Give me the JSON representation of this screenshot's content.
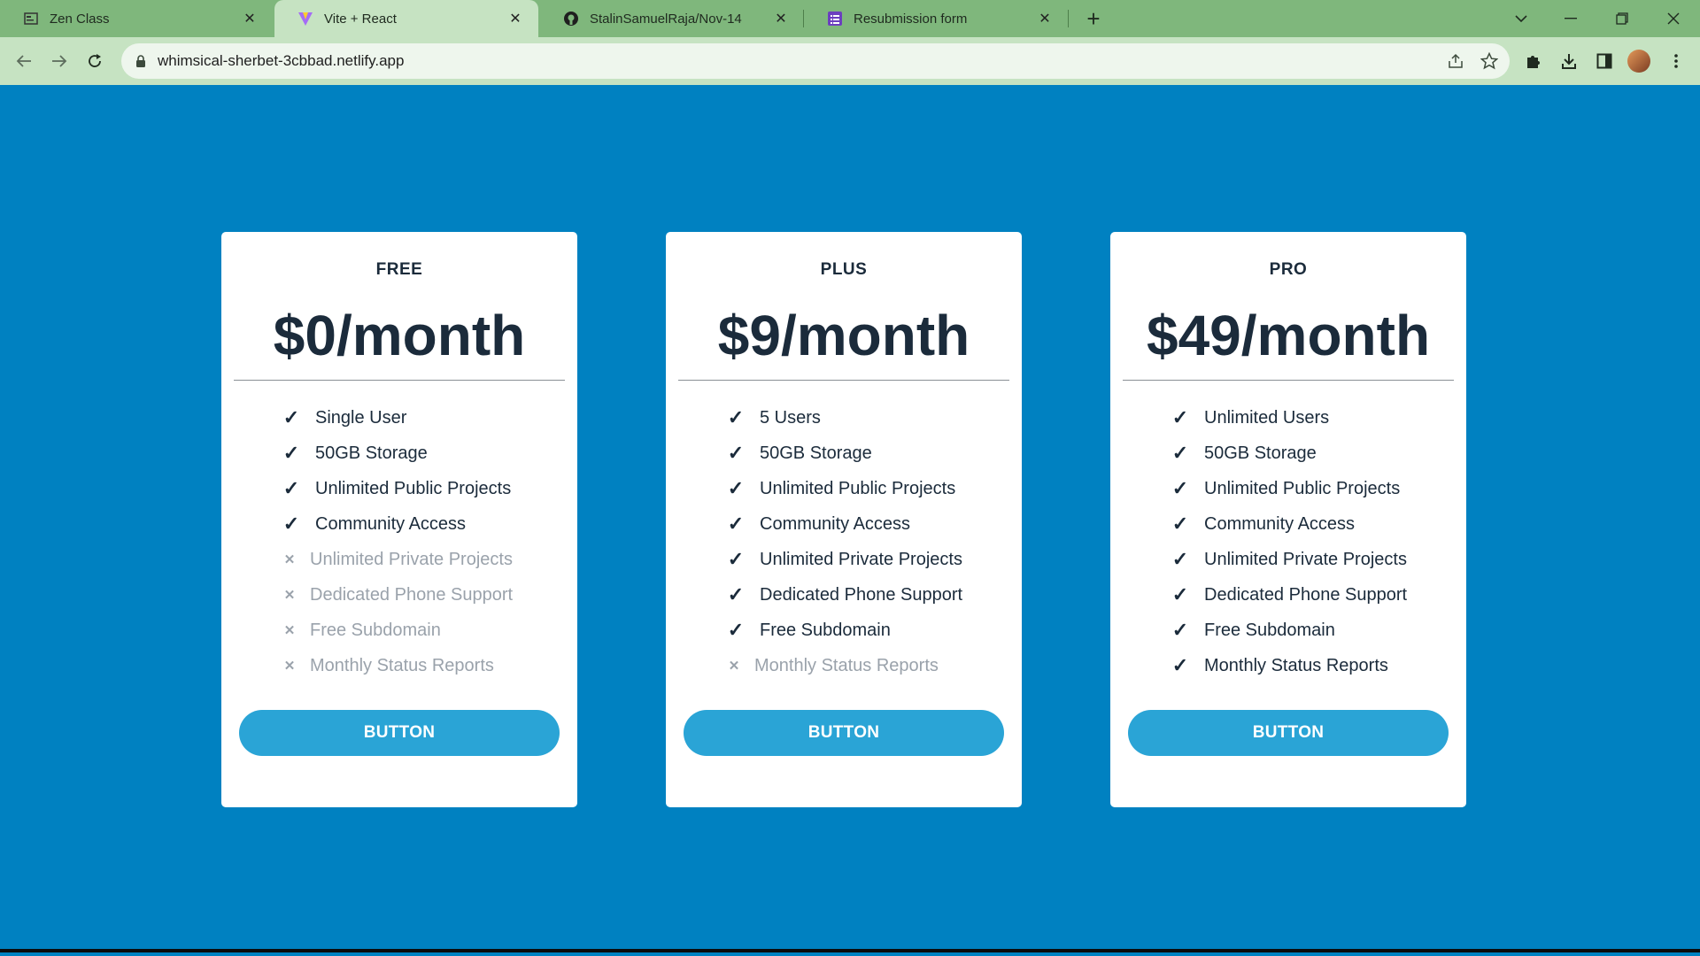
{
  "browser": {
    "tabs": [
      {
        "title": "Zen Class",
        "icon": "page-icon",
        "active": false
      },
      {
        "title": "Vite + React",
        "icon": "vite-icon",
        "active": true
      },
      {
        "title": "StalinSamuelRaja/Nov-14",
        "icon": "github-icon",
        "active": false
      },
      {
        "title": "Resubmission form",
        "icon": "form-icon",
        "active": false
      }
    ],
    "url": "whimsical-sherbet-3cbbad.netlify.app"
  },
  "plans": [
    {
      "name": "FREE",
      "price": "$0/month",
      "features": [
        {
          "label": "Single User",
          "included": true
        },
        {
          "label": "50GB Storage",
          "included": true
        },
        {
          "label": "Unlimited Public Projects",
          "included": true
        },
        {
          "label": "Community Access",
          "included": true
        },
        {
          "label": "Unlimited Private Projects",
          "included": false
        },
        {
          "label": "Dedicated Phone Support",
          "included": false
        },
        {
          "label": "Free Subdomain",
          "included": false
        },
        {
          "label": "Monthly Status Reports",
          "included": false
        }
      ],
      "button": "BUTTON"
    },
    {
      "name": "PLUS",
      "price": "$9/month",
      "features": [
        {
          "label": "5 Users",
          "included": true
        },
        {
          "label": "50GB Storage",
          "included": true
        },
        {
          "label": "Unlimited Public Projects",
          "included": true
        },
        {
          "label": "Community Access",
          "included": true
        },
        {
          "label": "Unlimited Private Projects",
          "included": true
        },
        {
          "label": "Dedicated Phone Support",
          "included": true
        },
        {
          "label": "Free Subdomain",
          "included": true
        },
        {
          "label": "Monthly Status Reports",
          "included": false
        }
      ],
      "button": "BUTTON"
    },
    {
      "name": "PRO",
      "price": "$49/month",
      "features": [
        {
          "label": "Unlimited Users",
          "included": true
        },
        {
          "label": "50GB Storage",
          "included": true
        },
        {
          "label": "Unlimited Public Projects",
          "included": true
        },
        {
          "label": "Community Access",
          "included": true
        },
        {
          "label": "Unlimited Private Projects",
          "included": true
        },
        {
          "label": "Dedicated Phone Support",
          "included": true
        },
        {
          "label": "Free Subdomain",
          "included": true
        },
        {
          "label": "Monthly Status Reports",
          "included": true
        }
      ],
      "button": "BUTTON"
    }
  ],
  "marks": {
    "included": "✓",
    "excluded": "✕"
  },
  "colors": {
    "background": "#0081c1",
    "card": "#ffffff",
    "button": "#2aa4d6",
    "text": "#1b2b3b",
    "muted": "#9aa2ab",
    "tabstrip": "#7fb77c",
    "toolbar": "#c6e3c2"
  }
}
